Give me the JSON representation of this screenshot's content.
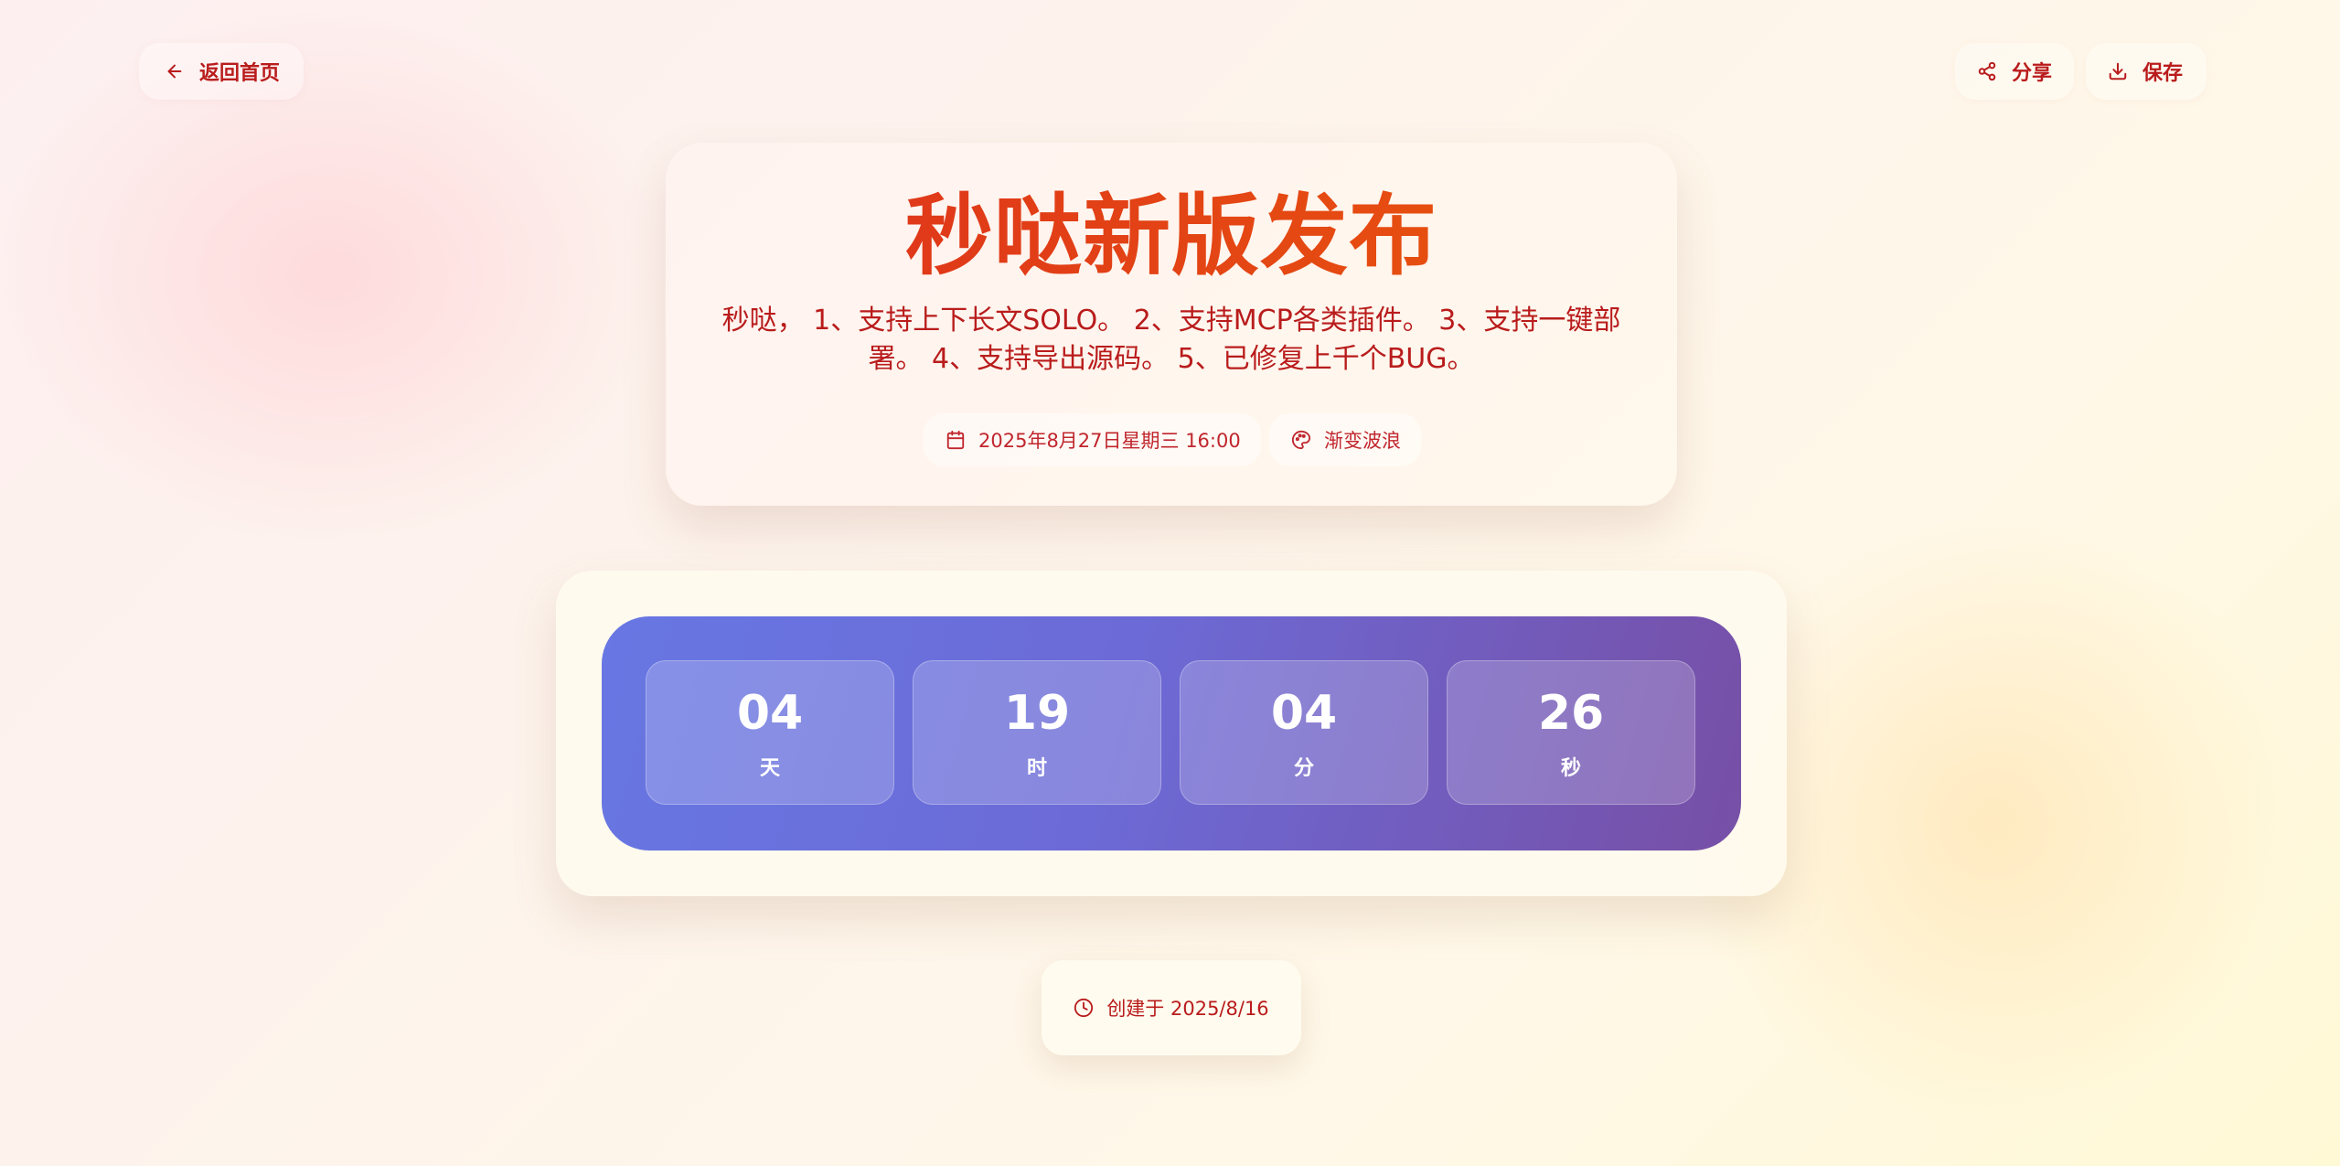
{
  "nav": {
    "back_label": "返回首页",
    "share_label": "分享",
    "save_label": "保存"
  },
  "hero": {
    "title": "秒哒新版发布",
    "description": "秒哒， 1、支持上下长文SOLO。 2、支持MCP各类插件。 3、支持一键部署。 4、支持导出源码。 5、已修复上千个BUG。",
    "date": "2025年8月27日星期三 16:00",
    "theme": "渐变波浪"
  },
  "countdown": {
    "days": {
      "value": "04",
      "label": "天"
    },
    "hours": {
      "value": "19",
      "label": "时"
    },
    "minutes": {
      "value": "04",
      "label": "分"
    },
    "seconds": {
      "value": "26",
      "label": "秒"
    }
  },
  "footer": {
    "created": "创建于 2025/8/16"
  },
  "colors": {
    "accent_red": "#b91c1c",
    "title_gradient_start": "#dc2f1e",
    "title_gradient_end": "#ea580c",
    "countdown_gradient_start": "#6777e3",
    "countdown_gradient_end": "#774fa6"
  },
  "icons": {
    "back": "arrow-left-icon",
    "share": "share-icon",
    "save": "download-icon",
    "date": "calendar-icon",
    "theme": "palette-icon",
    "created": "clock-icon"
  }
}
